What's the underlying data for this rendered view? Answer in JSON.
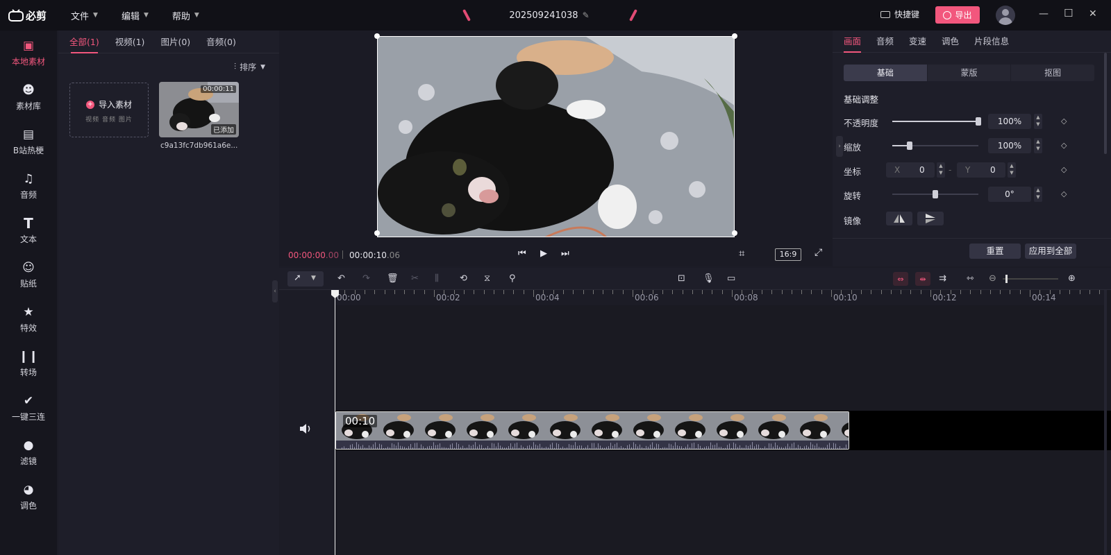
{
  "app": {
    "name": "必剪"
  },
  "menu": {
    "file": "文件",
    "edit": "编辑",
    "help": "帮助"
  },
  "project": {
    "name": "202509241038"
  },
  "topbar": {
    "shortcuts": "快捷键",
    "export": "导出"
  },
  "rail": [
    {
      "label": "本地素材",
      "icon": "upload-folder-icon",
      "active": true
    },
    {
      "label": "素材库",
      "icon": "library-icon"
    },
    {
      "label": "B站热梗",
      "icon": "bilibili-tv-icon"
    },
    {
      "label": "音频",
      "icon": "music-note-icon"
    },
    {
      "label": "文本",
      "icon": "text-icon"
    },
    {
      "label": "贴纸",
      "icon": "sticker-icon"
    },
    {
      "label": "特效",
      "icon": "sparkle-icon"
    },
    {
      "label": "转场",
      "icon": "transition-icon"
    },
    {
      "label": "一键三连",
      "icon": "thumbs-up-icon"
    },
    {
      "label": "滤镜",
      "icon": "filter-icon"
    },
    {
      "label": "调色",
      "icon": "palette-icon"
    }
  ],
  "media": {
    "tabs": [
      "全部(1)",
      "视频(1)",
      "图片(0)",
      "音频(0)"
    ],
    "sort": "排序",
    "import_title": "导入素材",
    "import_types": "视频 音频 图片",
    "item": {
      "duration": "00:00:11",
      "badge": "已添加",
      "filename": "c9a13fc7db961a6e..."
    }
  },
  "player": {
    "current": "00:00:00",
    "current_frames": ".00",
    "total": "00:00:10",
    "total_frames": ".06",
    "ratio": "16:9"
  },
  "props": {
    "tabs": [
      "画面",
      "音频",
      "变速",
      "调色",
      "片段信息"
    ],
    "segments": [
      "基础",
      "蒙版",
      "抠图"
    ],
    "section_title": "基础调整",
    "opacity": {
      "label": "不透明度",
      "value": "100%",
      "level": 1.0
    },
    "scale": {
      "label": "缩放",
      "value": "100%",
      "level": 0.2
    },
    "position": {
      "label": "坐标",
      "x_label": "X",
      "x": "0",
      "y_label": "Y",
      "y": "0"
    },
    "rotate": {
      "label": "旋转",
      "value": "0°",
      "level": 0.5
    },
    "mirror": {
      "label": "镜像"
    },
    "reset": "重置",
    "apply_all": "应用到全部"
  },
  "timeline": {
    "ruler": [
      "00:00",
      "00:02",
      "00:04",
      "00:06",
      "00:08",
      "00:10",
      "00:12",
      "00:14"
    ],
    "clip_duration": "00:10"
  },
  "colors": {
    "accent": "#f2577d"
  }
}
